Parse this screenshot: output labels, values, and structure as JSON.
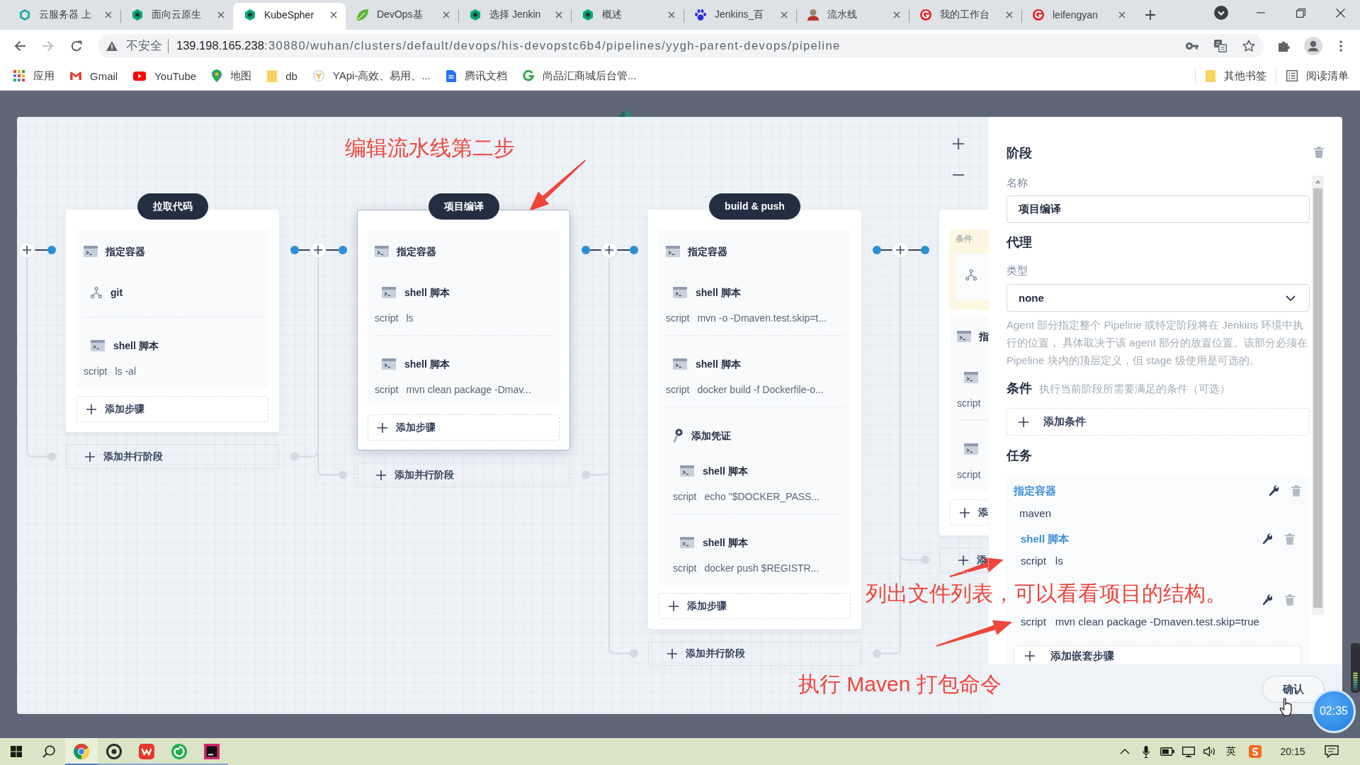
{
  "browser": {
    "tabs": [
      {
        "kind": "hexring",
        "title": "云服务器 上",
        "selected": false
      },
      {
        "kind": "hexagon",
        "title": "面向云原生",
        "selected": false
      },
      {
        "kind": "hexagon",
        "title": "KubeSpher",
        "selected": true
      },
      {
        "kind": "leaf",
        "title": "DevOps基",
        "selected": false
      },
      {
        "kind": "hexagon",
        "title": "选择 Jenkin",
        "selected": false
      },
      {
        "kind": "hexagon",
        "title": "概述",
        "selected": false
      },
      {
        "kind": "paw",
        "title": "Jenkins_百",
        "selected": false
      },
      {
        "kind": "person",
        "title": "流水线",
        "selected": false
      },
      {
        "kind": "disc",
        "title": "我的工作台",
        "selected": false
      },
      {
        "kind": "disc",
        "title": "leifengyan",
        "selected": false
      }
    ],
    "navigation": [
      {
        "kind": "back",
        "disabled": false
      },
      {
        "kind": "forward",
        "disabled": true
      },
      {
        "kind": "reload",
        "disabled": false
      }
    ],
    "address_bar": {
      "security": "不安全",
      "url_host": "139.198.165.238",
      "url_path": ":30880/wuhan/clusters/default/devops/his-devopstc6b4/pipelines/yygh-parent-devops/pipeline"
    },
    "bookmarks": [
      {
        "kind": "grid",
        "label": "应用"
      },
      {
        "kind": "mail",
        "label": "Gmail"
      },
      {
        "kind": "video",
        "label": "YouTube"
      },
      {
        "kind": "map",
        "label": "地图"
      },
      {
        "kind": "folder",
        "label": "db"
      },
      {
        "kind": "fork",
        "label": "YApi-高效、易用、..."
      },
      {
        "kind": "document",
        "label": "腾讯文档"
      },
      {
        "kind": "ring",
        "label": "尚品汇商城后台管..."
      }
    ],
    "bookmarks_right": [
      {
        "kind": "folder",
        "label": "其他书签"
      },
      {
        "kind": "list",
        "label": "阅读清单"
      }
    ]
  },
  "pipeline_editor": {
    "stages": [
      {
        "title": "拉取代码",
        "selected": false,
        "container": {
          "label": "指定容器",
          "steps": [
            {
              "kind": "git",
              "label": "git"
            },
            {
              "kind": "shell",
              "label": "shell 脚本",
              "script_label": "script",
              "script": "ls -al"
            }
          ]
        },
        "add_step": "添加步骤",
        "add_parallel": "添加并行阶段"
      },
      {
        "title": "项目编译",
        "selected": true,
        "container": {
          "label": "指定容器",
          "steps": [
            {
              "kind": "shell",
              "label": "shell 脚本",
              "script_label": "script",
              "script": "ls"
            },
            {
              "kind": "shell",
              "label": "shell 脚本",
              "script_label": "script",
              "script": "mvn clean package -Dmav..."
            }
          ]
        },
        "add_step": "添加步骤",
        "add_parallel": "添加并行阶段"
      },
      {
        "title": "build & push",
        "selected": false,
        "container": {
          "label": "指定容器",
          "steps": [
            {
              "kind": "shell",
              "label": "shell 脚本",
              "script_label": "script",
              "script": "mvn -o -Dmaven.test.skip=t..."
            },
            {
              "kind": "shell",
              "label": "shell 脚本",
              "script_label": "script",
              "script": "docker build -f Dockerfile-o..."
            },
            {
              "kind": "credential",
              "label": "添加凭证",
              "children": [
                {
                  "kind": "shell",
                  "label": "shell 脚本",
                  "script_label": "script",
                  "script": "echo \"$DOCKER_PASS..."
                },
                {
                  "kind": "shell",
                  "label": "shell 脚本",
                  "script_label": "script",
                  "script": "docker push $REGISTR..."
                }
              ]
            }
          ]
        },
        "add_step": "添加步骤",
        "add_parallel": "添加并行阶段"
      },
      {
        "selected": false,
        "condition": {
          "label": "条件",
          "steps": [
            {
              "kind": "git"
            }
          ]
        },
        "container": {
          "label": "指",
          "steps": [
            {
              "kind": "shell",
              "script_label": "script"
            },
            {
              "kind": "shell",
              "script_label": "script"
            }
          ]
        },
        "add_step": "添",
        "add_parallel": "添"
      }
    ],
    "stage_panel": {
      "title": "阶段",
      "name_label": "名称",
      "name_value": "项目编译",
      "agent_heading": "代理",
      "type_label": "类型",
      "type_value": "none",
      "agent_description": "Agent 部分指定整个 Pipeline 或特定阶段将在 Jenkins 环境中执行的位置， 具体取决于该 agent 部分的放置位置。该部分必须在 Pipeline 块内的顶层定义，但 stage 级使用是可选的。",
      "condition_heading": "条件",
      "condition_hint": "执行当前阶段所需要满足的条件（可选）",
      "add_condition": "添加条件",
      "tasks_heading": "任务",
      "tasks": [
        {
          "label": "指定容器",
          "value": "maven",
          "children": [
            {
              "label": "shell 脚本",
              "script_label": "script",
              "script": "ls"
            },
            {
              "script_label": "script",
              "script": "mvn clean package -Dmaven.test.skip=true"
            }
          ]
        }
      ],
      "add_nested_step": "添加嵌套步骤",
      "confirm": "确认"
    },
    "annotations": [
      {
        "text": "编辑流水线第二步"
      },
      {
        "text": "列出文件列表，可以看看项目的结构。"
      },
      {
        "text": "执行 Maven 打包命令"
      }
    ]
  },
  "recording_timer": "02:35",
  "taskbar": {
    "apps": [
      {
        "kind": "browser",
        "selected": true
      },
      {
        "kind": "ring",
        "selected": false
      },
      {
        "kind": "tile",
        "selected": false
      },
      {
        "kind": "spiral",
        "selected": false
      },
      {
        "kind": "square",
        "selected": false
      }
    ],
    "ime": "英",
    "clock": "20:15"
  }
}
